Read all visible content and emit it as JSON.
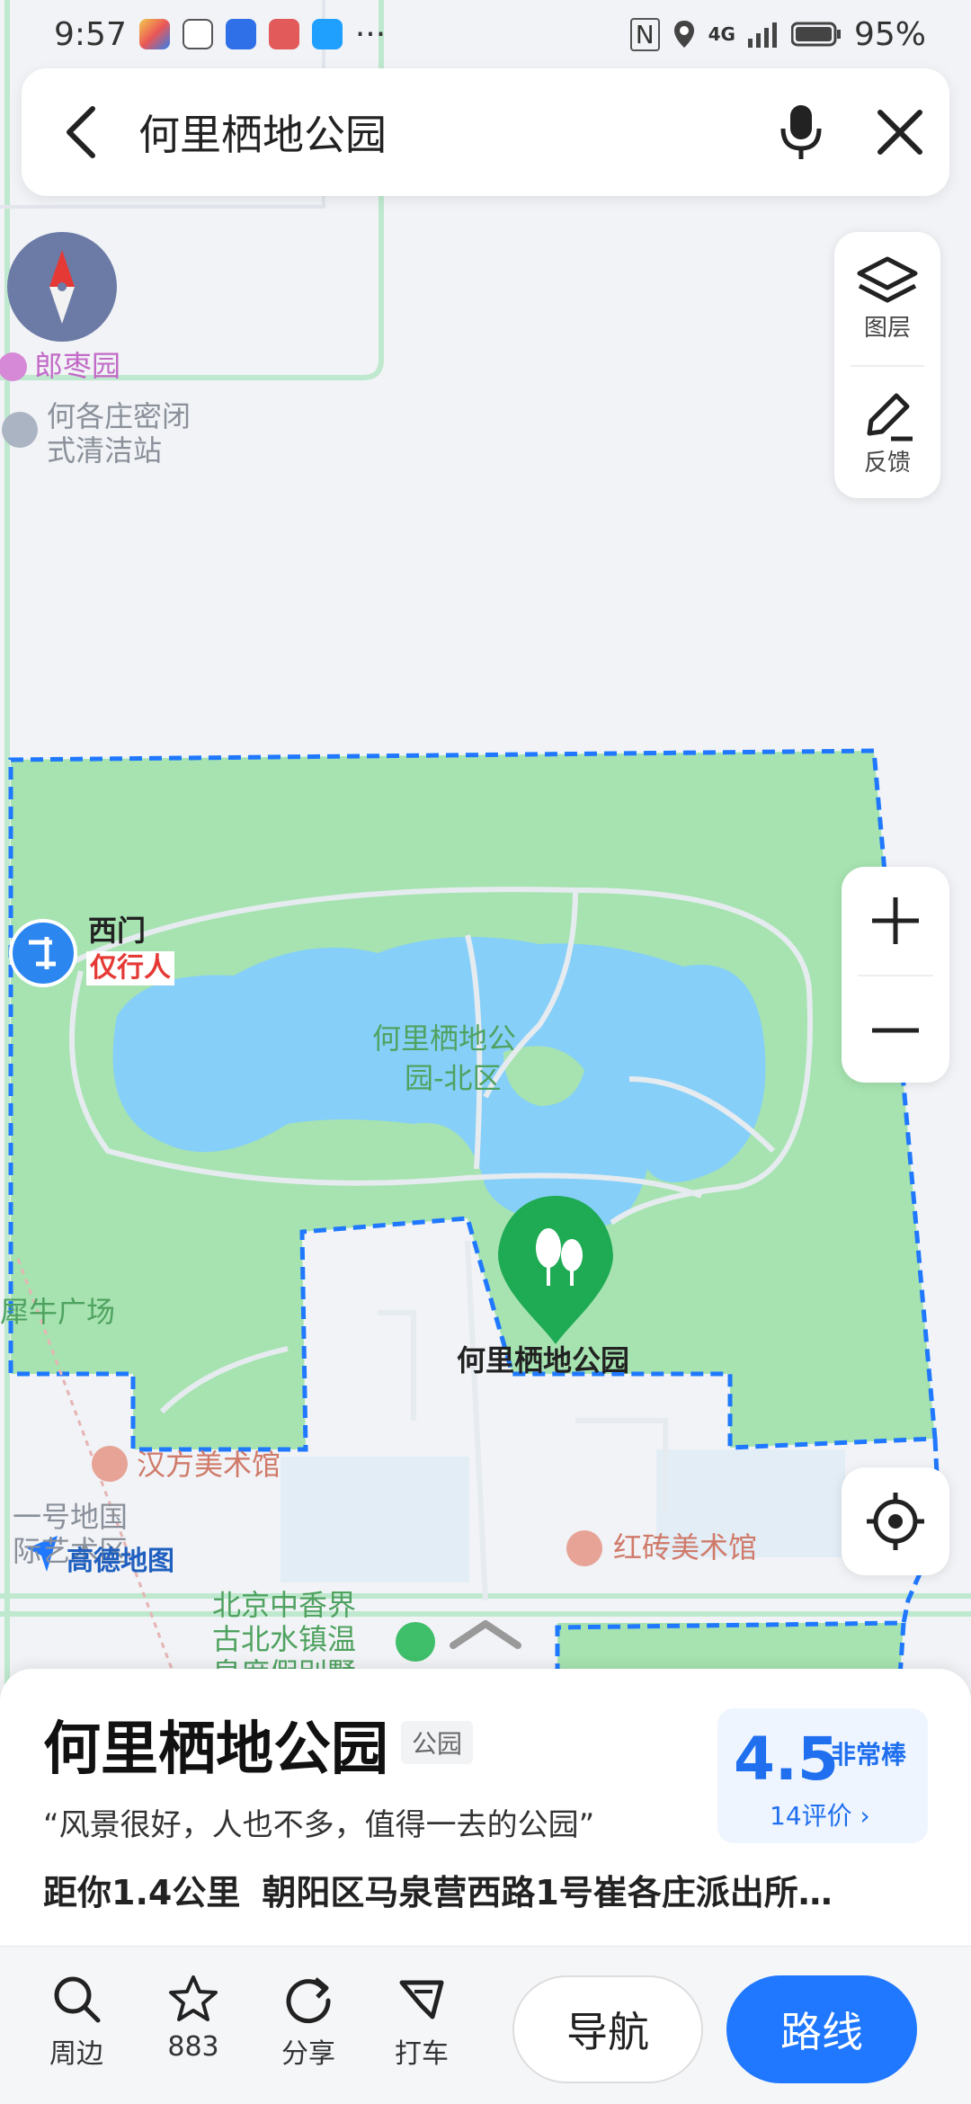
{
  "status_bar": {
    "time": "9:57",
    "more": "···",
    "network": "4G",
    "battery": "95%",
    "app_icons": [
      "colorful-app-icon",
      "text-app-icon",
      "blue-app-icon",
      "red-app-icon",
      "search-app-icon"
    ]
  },
  "search": {
    "query": "何里栖地公园"
  },
  "layers": {
    "layers_label": "图层",
    "feedback_label": "反馈"
  },
  "map_labels": {
    "poi_1": "郎枣园",
    "poi_2_line1": "何各庄密闭",
    "poi_2_line2": "式清洁站",
    "west_gate": "西门",
    "pedestrian_only": "仅行人",
    "park_area_line1": "何里栖地公",
    "park_area_line2": "园-北区",
    "pin_label": "何里栖地公园",
    "square": "犀牛广场",
    "gallery_1": "汉方美术馆",
    "map_1": "一号地国",
    "map_1b": "际艺术区",
    "amap_logo": "高德地图",
    "gallery_2": "红砖美术馆",
    "resort_line1": "北京中香界",
    "resort_line2": "古北水镇温",
    "resort_line3": "泉度假别墅"
  },
  "place": {
    "name": "何里栖地公园",
    "tag": "公园",
    "quote": "“风景很好，人也不多，值得一去的公园”",
    "distance": "距你1.4公里",
    "address": "朝阳区马泉营西路1号崔各庄派出所…",
    "rating_score": "4.5",
    "rating_level": "非常棒",
    "review_count": "14评价 ›"
  },
  "toolbar": {
    "nearby": "周边",
    "favorites": "883",
    "share": "分享",
    "taxi": "打车",
    "navigate": "导航",
    "route": "路线"
  },
  "colors": {
    "park_green": "#a6e3b0",
    "lake_blue": "#86cff9",
    "boundary_blue": "#1f78ff",
    "accent": "#1f78ff"
  }
}
